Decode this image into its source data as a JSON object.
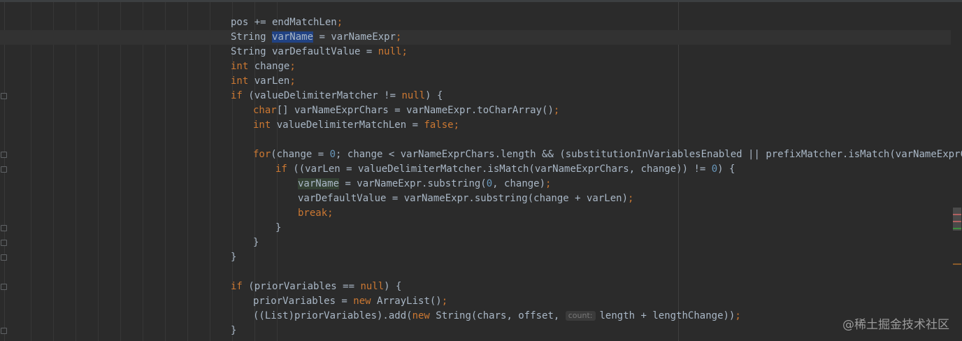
{
  "editor": {
    "lines": [
      {
        "indent": 0,
        "tokens": [
          {
            "t": "pos += endMatchLen",
            "c": "var"
          },
          {
            "t": ";",
            "c": "kw"
          }
        ]
      },
      {
        "indent": 0,
        "current": true,
        "tokens": [
          {
            "t": "String ",
            "c": "var"
          },
          {
            "t": "varName",
            "c": "sel"
          },
          {
            "t": " = varNameExpr",
            "c": "var"
          },
          {
            "t": ";",
            "c": "kw"
          }
        ]
      },
      {
        "indent": 0,
        "tokens": [
          {
            "t": "String varDefaultValue = ",
            "c": "var"
          },
          {
            "t": "null",
            "c": "kw"
          },
          {
            "t": ";",
            "c": "kw"
          }
        ]
      },
      {
        "indent": 0,
        "tokens": [
          {
            "t": "int",
            "c": "kw"
          },
          {
            "t": " change",
            "c": "var"
          },
          {
            "t": ";",
            "c": "kw"
          }
        ]
      },
      {
        "indent": 0,
        "tokens": [
          {
            "t": "int",
            "c": "kw"
          },
          {
            "t": " varLen",
            "c": "var"
          },
          {
            "t": ";",
            "c": "kw"
          }
        ]
      },
      {
        "indent": 0,
        "tokens": [
          {
            "t": "if",
            "c": "kw"
          },
          {
            "t": " (valueDelimiterMatcher != ",
            "c": "var"
          },
          {
            "t": "null",
            "c": "kw"
          },
          {
            "t": ") {",
            "c": "var"
          }
        ]
      },
      {
        "indent": 1,
        "tokens": [
          {
            "t": "char",
            "c": "kw"
          },
          {
            "t": "[] varNameExprChars = varNameExpr.toCharArray()",
            "c": "var"
          },
          {
            "t": ";",
            "c": "kw"
          }
        ]
      },
      {
        "indent": 1,
        "tokens": [
          {
            "t": "int",
            "c": "kw"
          },
          {
            "t": " valueDelimiterMatchLen = ",
            "c": "var"
          },
          {
            "t": "false",
            "c": "kw"
          },
          {
            "t": ";",
            "c": "kw"
          }
        ]
      },
      {
        "indent": 0,
        "tokens": []
      },
      {
        "indent": 1,
        "tokens": [
          {
            "t": "for",
            "c": "kw"
          },
          {
            "t": "(change = ",
            "c": "var"
          },
          {
            "t": "0",
            "c": "num"
          },
          {
            "t": "; change < varNameExprChars.length && (substitutionInVariablesEnabled || prefixMatcher.isMatch(varNameExprChars,",
            "c": "var"
          }
        ]
      },
      {
        "indent": 2,
        "tokens": [
          {
            "t": "if",
            "c": "kw"
          },
          {
            "t": " ((varLen = valueDelimiterMatcher.isMatch(varNameExprChars, change)) != ",
            "c": "var"
          },
          {
            "t": "0",
            "c": "num"
          },
          {
            "t": ") {",
            "c": "var"
          }
        ]
      },
      {
        "indent": 3,
        "tokens": [
          {
            "t": "varName",
            "c": "read"
          },
          {
            "t": " = varNameExpr.substring(",
            "c": "var"
          },
          {
            "t": "0",
            "c": "num"
          },
          {
            "t": ", change)",
            "c": "var"
          },
          {
            "t": ";",
            "c": "kw"
          }
        ]
      },
      {
        "indent": 3,
        "tokens": [
          {
            "t": "varDefaultValue = varNameExpr.substring(change + varLen)",
            "c": "var"
          },
          {
            "t": ";",
            "c": "kw"
          }
        ]
      },
      {
        "indent": 3,
        "tokens": [
          {
            "t": "break",
            "c": "kw"
          },
          {
            "t": ";",
            "c": "kw"
          }
        ]
      },
      {
        "indent": 2,
        "tokens": [
          {
            "t": "}",
            "c": "var"
          }
        ]
      },
      {
        "indent": 1,
        "tokens": [
          {
            "t": "}",
            "c": "var"
          }
        ]
      },
      {
        "indent": 0,
        "tokens": [
          {
            "t": "}",
            "c": "var"
          }
        ]
      },
      {
        "indent": 0,
        "tokens": []
      },
      {
        "indent": 0,
        "tokens": [
          {
            "t": "if",
            "c": "kw"
          },
          {
            "t": " (priorVariables == ",
            "c": "var"
          },
          {
            "t": "null",
            "c": "kw"
          },
          {
            "t": ") {",
            "c": "var"
          }
        ]
      },
      {
        "indent": 1,
        "tokens": [
          {
            "t": "priorVariables = ",
            "c": "var"
          },
          {
            "t": "new",
            "c": "kw"
          },
          {
            "t": " ArrayList()",
            "c": "var"
          },
          {
            "t": ";",
            "c": "kw"
          }
        ]
      },
      {
        "indent": 1,
        "tokens": [
          {
            "t": "((List)priorVariables).add(",
            "c": "var"
          },
          {
            "t": "new",
            "c": "kw"
          },
          {
            "t": " String(chars, offset, ",
            "c": "var"
          },
          {
            "t": "count:",
            "c": "hint"
          },
          {
            "t": "length + lengthChange))",
            "c": "var"
          },
          {
            "t": ";",
            "c": "kw"
          }
        ]
      },
      {
        "indent": 0,
        "tokens": [
          {
            "t": "}",
            "c": "var"
          }
        ]
      }
    ]
  },
  "icons": {
    "intention_bulb": "lightbulb-icon",
    "fold_marker": "fold-marker-icon"
  },
  "colors": {
    "background": "#2b2b2b",
    "keyword": "#cc7832",
    "number": "#6897bb",
    "identifier": "#a9b7c6",
    "selection": "#214283"
  },
  "watermark": "@稀土掘金技术社区"
}
